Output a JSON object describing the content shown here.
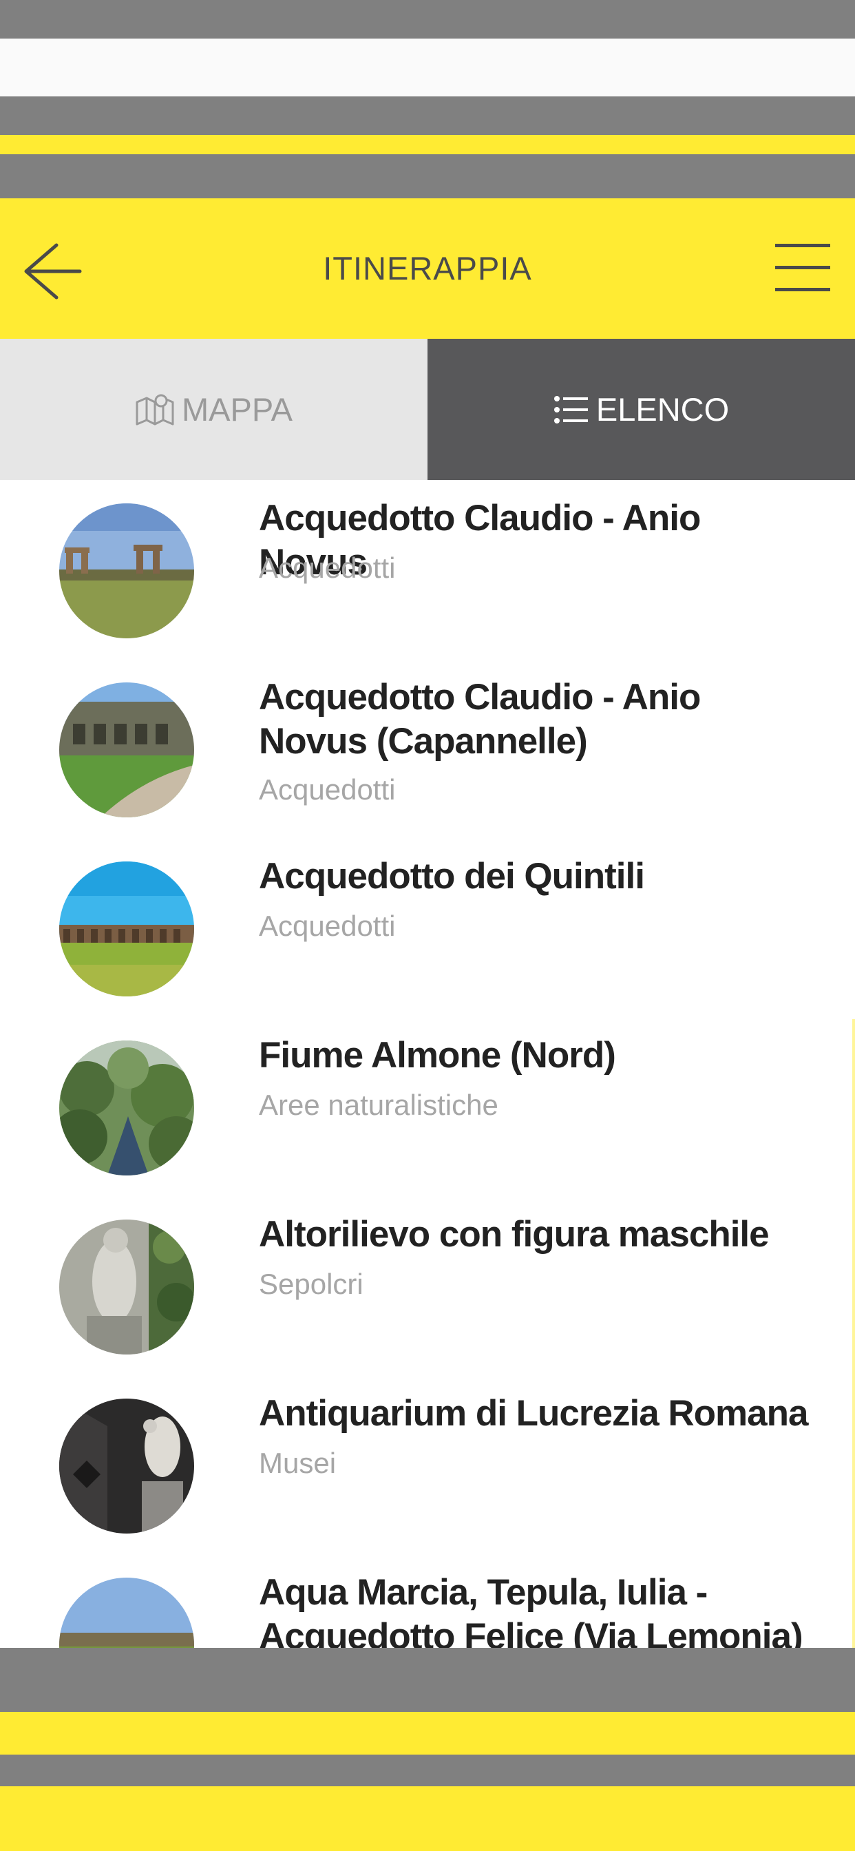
{
  "header": {
    "title": "ITINERAPPIA"
  },
  "tabs": [
    {
      "label": "MAPPA",
      "icon": "map-icon",
      "active": false
    },
    {
      "label": "ELENCO",
      "icon": "list-icon",
      "active": true
    }
  ],
  "items": [
    {
      "title": "Acquedotto Claudio - Anio Novus",
      "category": "Acquedotti"
    },
    {
      "title": "Acquedotto Claudio - Anio Novus (Capannelle)",
      "category": "Acquedotti"
    },
    {
      "title": "Acquedotto dei Quintili",
      "category": "Acquedotti"
    },
    {
      "title": "Fiume Almone (Nord)",
      "category": "Aree naturalistiche"
    },
    {
      "title": "Altorilievo con figura maschile",
      "category": "Sepolcri"
    },
    {
      "title": "Antiquarium di Lucrezia Romana",
      "category": "Musei"
    },
    {
      "title": "Aqua Marcia, Tepula, Iulia - Acquedotto Felice (Via Lemonia)",
      "category": ""
    }
  ],
  "colors": {
    "accent_yellow": "#ffeb33",
    "tab_active_bg": "#58585a",
    "tab_inactive_bg": "#e6e6e6",
    "band_gray": "#808080"
  }
}
